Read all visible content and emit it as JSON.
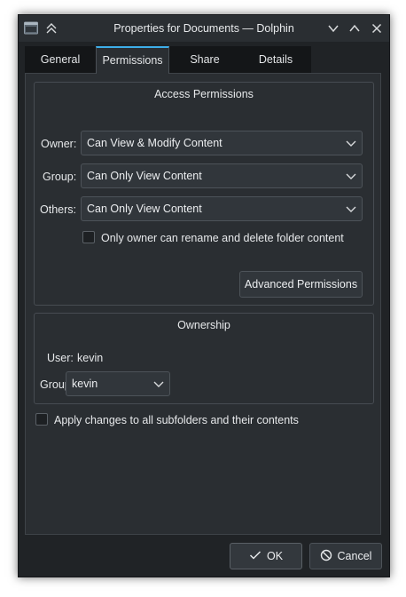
{
  "window": {
    "title": "Properties for Documents — Dolphin",
    "icons": [
      "folder-icon",
      "keep-above-icon",
      "minimize-icon",
      "maximize-icon",
      "close-icon"
    ]
  },
  "tabs": [
    {
      "label": "General"
    },
    {
      "label": "Permissions",
      "active": true
    },
    {
      "label": "Share"
    },
    {
      "label": "Details"
    }
  ],
  "access": {
    "title": "Access Permissions",
    "owner": {
      "label": "Owner:",
      "value": "Can View & Modify Content"
    },
    "group": {
      "label": "Group:",
      "value": "Can Only View Content"
    },
    "others": {
      "label": "Others:",
      "value": "Can Only View Content"
    },
    "only_owner_checkbox": {
      "label": "Only owner can rename and delete folder content",
      "checked": false
    },
    "advanced_button": "Advanced Permissions"
  },
  "ownership": {
    "title": "Ownership",
    "user_label": "User:",
    "user_value": "kevin",
    "group_label": "Group:",
    "group_value": "kevin"
  },
  "apply_checkbox": {
    "label": "Apply changes to all subfolders and their contents",
    "checked": false
  },
  "buttons": {
    "ok": "OK",
    "cancel": "Cancel"
  },
  "colors": {
    "accent": "#3daee9",
    "window_bg": "#202326",
    "panel_bg": "#2a2e32"
  }
}
